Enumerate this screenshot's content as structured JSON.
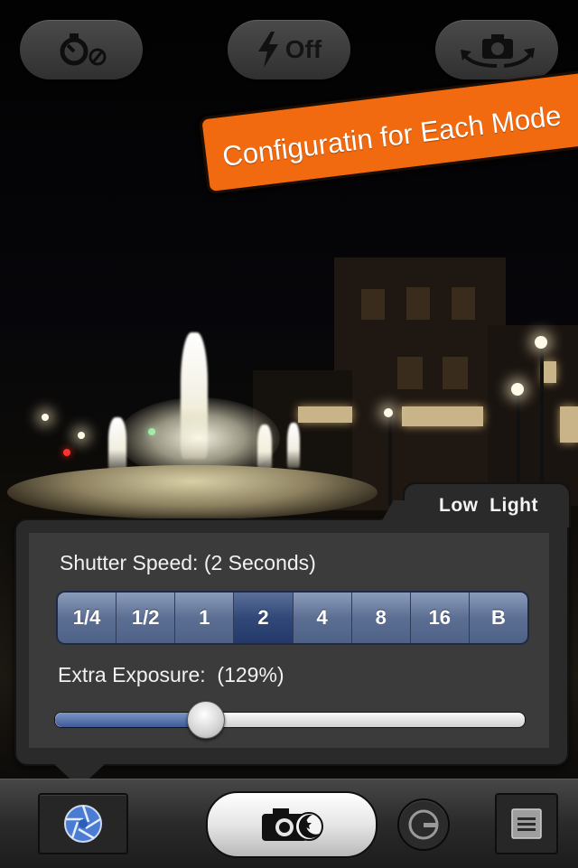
{
  "top_bar": {
    "timer": {
      "icon": "self-timer-off-icon"
    },
    "flash": {
      "icon": "flash-icon",
      "label": "Off"
    },
    "camera_switch": {
      "icon": "camera-switch-icon"
    }
  },
  "banner": {
    "text": "Configuratin for Each Mode",
    "color": "#f26a0f"
  },
  "settings_panel": {
    "mode_tab": "Low  Light",
    "shutter_speed": {
      "label": "Shutter Speed: (2 Seconds)",
      "options": [
        "1/4",
        "1/2",
        "1",
        "2",
        "4",
        "8",
        "16",
        "B"
      ],
      "selected": "2"
    },
    "extra_exposure": {
      "label": "Extra Exposure:  (129%)",
      "slider_fraction": 0.32
    }
  },
  "toolbar": {
    "mode_button_icon": "aperture-icon",
    "shutter_button_icon": "camera-night-icon",
    "toggle_icon": "power-toggle-icon",
    "menu_icon": "list-menu-icon"
  },
  "colors": {
    "accent_orange": "#f26a0f",
    "segment_blue": "#5c6f93",
    "segment_selected": "#314878",
    "aperture_blue": "#4a7cd4"
  }
}
